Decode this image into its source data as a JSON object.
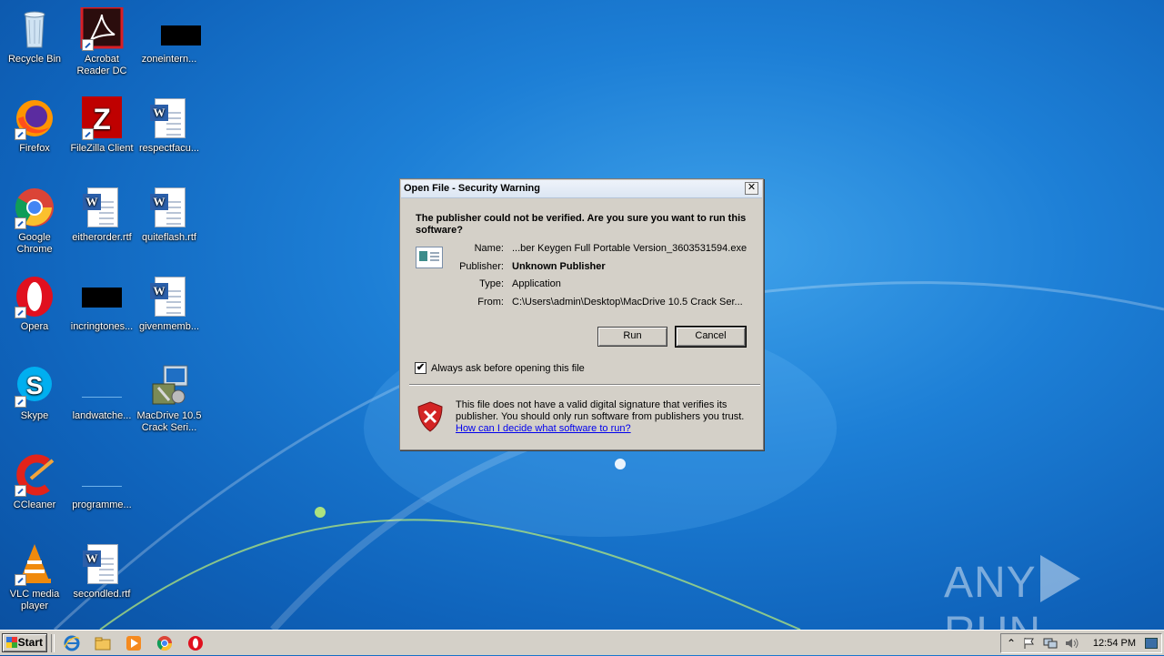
{
  "desktop_icons": [
    {
      "label": "Recycle Bin",
      "icon": "recycle-bin-icon"
    },
    {
      "label": "Acrobat Reader DC",
      "icon": "acrobat-icon"
    },
    {
      "label": "zoneintern...",
      "icon": "blank-file-icon"
    },
    {
      "label": "Firefox",
      "icon": "firefox-icon"
    },
    {
      "label": "FileZilla Client",
      "icon": "filezilla-icon"
    },
    {
      "label": "respectfacu...",
      "icon": "word-document-icon"
    },
    {
      "label": "Google Chrome",
      "icon": "chrome-icon"
    },
    {
      "label": "eitherorder.rtf",
      "icon": "word-document-icon"
    },
    {
      "label": "quiteflash.rtf",
      "icon": "word-document-icon"
    },
    {
      "label": "Opera",
      "icon": "opera-icon"
    },
    {
      "label": "incringtones...",
      "icon": "blank-file-icon"
    },
    {
      "label": "givenmemb...",
      "icon": "word-document-icon"
    },
    {
      "label": "Skype",
      "icon": "skype-icon"
    },
    {
      "label": "landwatche...",
      "icon": "blank-file-icon"
    },
    {
      "label": "MacDrive 10.5 Crack Seri...",
      "icon": "installer-icon"
    },
    {
      "label": "CCleaner",
      "icon": "ccleaner-icon"
    },
    {
      "label": "programme...",
      "icon": "blank-file-icon"
    },
    {
      "label": "VLC media player",
      "icon": "vlc-icon"
    },
    {
      "label": "secondled.rtf",
      "icon": "word-document-icon"
    }
  ],
  "dialog": {
    "title": "Open File - Security Warning",
    "close_glyph": "✕",
    "question": "The publisher could not be verified.  Are you sure you want to run this software?",
    "fields": [
      {
        "key": "Name:",
        "value": "...ber Keygen Full Portable Version_3603531594.exe",
        "bold": false
      },
      {
        "key": "Publisher:",
        "value": "Unknown Publisher",
        "bold": true
      },
      {
        "key": "Type:",
        "value": "Application",
        "bold": false
      },
      {
        "key": "From:",
        "value": "C:\\Users\\admin\\Desktop\\MacDrive 10.5 Crack  Ser...",
        "bold": false
      }
    ],
    "run_label": "Run",
    "cancel_label": "Cancel",
    "checkbox_label": "Always ask before opening this file",
    "checkbox_checked": true,
    "checkbox_glyph": "✔",
    "warning_text": "This file does not have a valid digital signature that verifies its publisher.  You should only run software from publishers you trust.",
    "help_link": "How can I decide what software to run?"
  },
  "taskbar": {
    "start_label": "Start",
    "clock": "12:54 PM",
    "tray_expand_glyph": "⌃"
  },
  "watermark": {
    "left": "ANY",
    "right": "RUN"
  },
  "colors": {
    "desktop_bg": "#1d7fd6",
    "dialog_bg": "#d4d0c8",
    "link": "#0000ee"
  }
}
